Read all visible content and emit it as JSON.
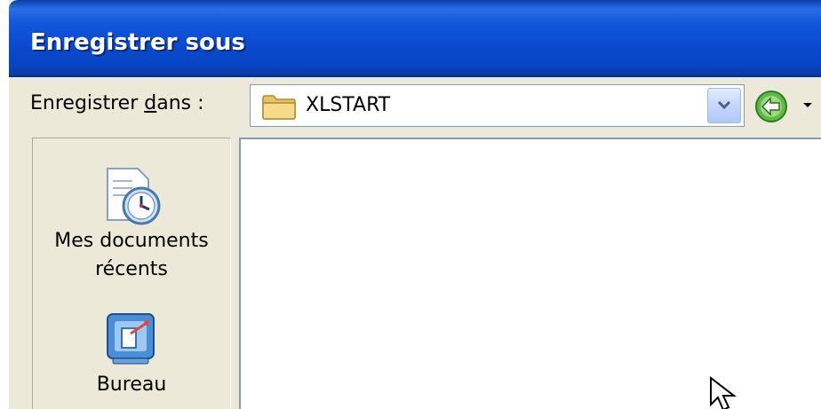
{
  "window": {
    "title": "Enregistrer sous"
  },
  "toolbar": {
    "save_in_label_prefix": "Enregistrer ",
    "save_in_label_accel": "d",
    "save_in_label_suffix": "ans :",
    "location_value": "XLSTART",
    "location_icon": "folder-icon",
    "dropdown_icon": "chevron-down-icon",
    "back_icon": "back-arrow-icon"
  },
  "places_bar": {
    "items": [
      {
        "label_line1": "Mes documents",
        "label_line2": "récents",
        "icon": "recent-documents-icon"
      },
      {
        "label_line1": "Bureau",
        "icon": "desktop-icon"
      }
    ]
  },
  "colors": {
    "titlebar": "#0a4ad0",
    "dialog_bg": "#ece9d8",
    "border": "#7f9db9"
  }
}
